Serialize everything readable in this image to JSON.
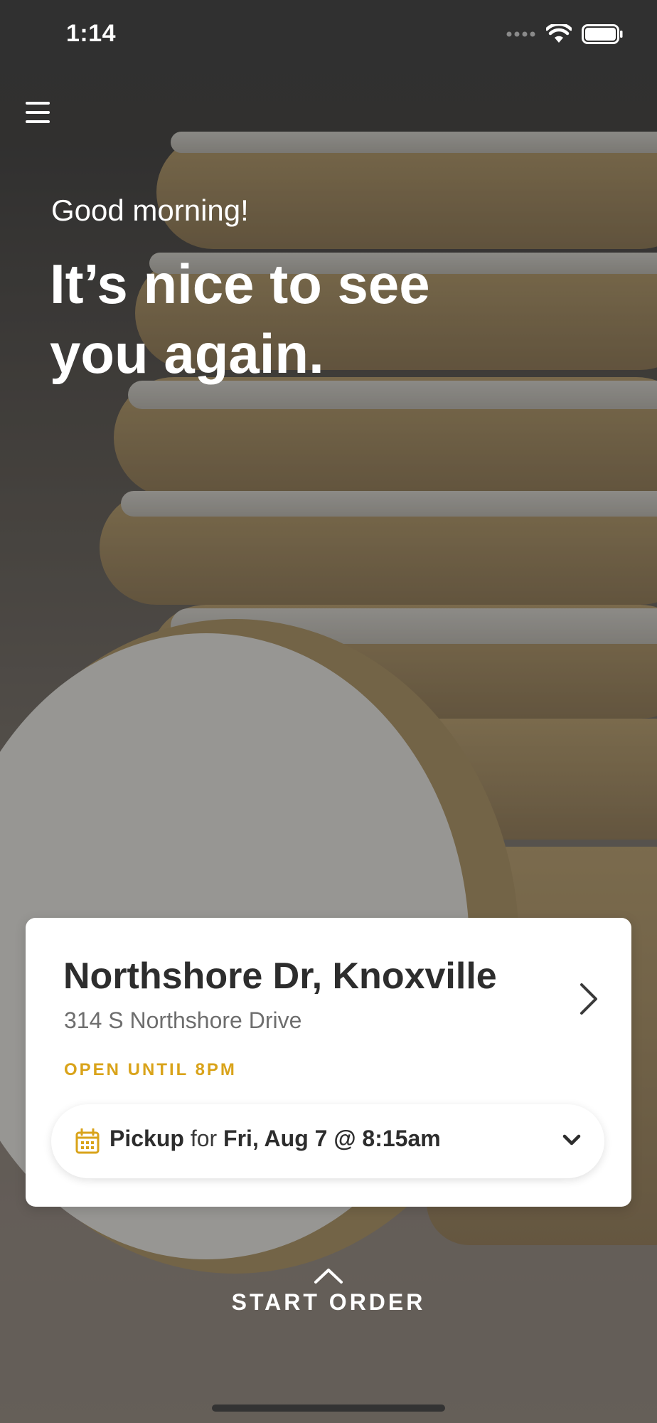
{
  "status_bar": {
    "time": "1:14"
  },
  "greeting": {
    "small": "Good morning!",
    "headline": "It’s nice to see you again."
  },
  "store": {
    "name": "Northshore Dr, Knoxville",
    "address": "314 S Northshore Drive",
    "hours": "OPEN UNTIL 8PM",
    "accent_color": "#d9a31a"
  },
  "pickup": {
    "mode": "Pickup",
    "connector": "for",
    "time": "Fri, Aug 7 @ 8:15am"
  },
  "start_order": {
    "label": "START ORDER"
  },
  "icons": {
    "menu": "hamburger-menu-icon",
    "store_chevron": "chevron-right-icon",
    "calendar": "calendar-icon",
    "pickup_chevron": "chevron-down-icon",
    "start_order": "chevron-up-icon"
  }
}
